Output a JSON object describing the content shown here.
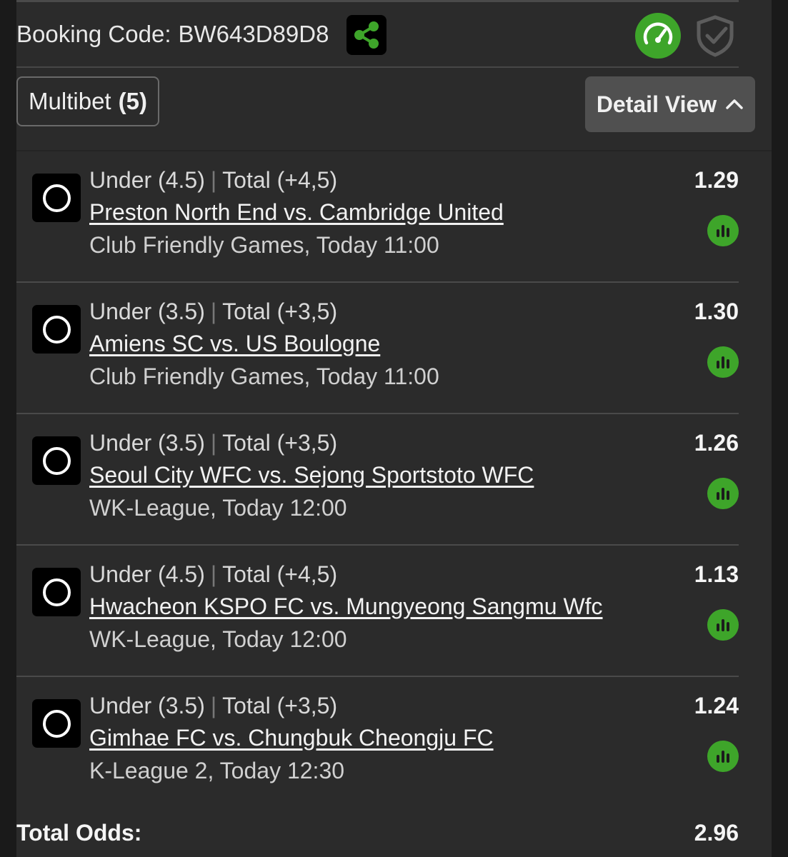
{
  "booking": {
    "label": "Booking Code:",
    "code": "BW643D89D8"
  },
  "toolbar": {
    "multibet_label": "Multibet",
    "multibet_count": "(5)",
    "detail_label": "Detail View"
  },
  "bets": [
    {
      "selection": "Under (4.5)",
      "separator": "|",
      "market": "Total (+4,5)",
      "match": "Preston North End vs. Cambridge United",
      "league_time": "Club Friendly Games, Today 11:00",
      "odds": "1.29"
    },
    {
      "selection": "Under (3.5)",
      "separator": "|",
      "market": "Total (+3,5)",
      "match": "Amiens SC vs. US Boulogne",
      "league_time": "Club Friendly Games, Today 11:00",
      "odds": "1.30"
    },
    {
      "selection": "Under (3.5)",
      "separator": "|",
      "market": "Total (+3,5)",
      "match": "Seoul City WFC vs. Sejong Sportstoto WFC",
      "league_time": "WK-League, Today 12:00",
      "odds": "1.26"
    },
    {
      "selection": "Under (4.5)",
      "separator": "|",
      "market": "Total (+4,5)",
      "match": "Hwacheon KSPO FC vs. Mungyeong Sangmu Wfc",
      "league_time": "WK-League, Today 12:00",
      "odds": "1.13"
    },
    {
      "selection": "Under (3.5)",
      "separator": "|",
      "market": "Total (+3,5)",
      "match": "Gimhae FC vs. Chungbuk Cheongju FC",
      "league_time": "K-League 2, Today 12:30",
      "odds": "1.24"
    }
  ],
  "total": {
    "label": "Total Odds:",
    "value": "2.96"
  },
  "icons": {
    "share": "share-icon",
    "speedometer": "speedometer-icon",
    "shield": "shield-check-icon",
    "chevron": "chevron-up-icon",
    "radio": "radio-unchecked-icon",
    "stats": "bar-chart-icon"
  },
  "colors": {
    "background": "#2b2b2b",
    "accent_green": "#3ea52a",
    "button_gray": "#505050",
    "text": "#f2f2f2"
  }
}
